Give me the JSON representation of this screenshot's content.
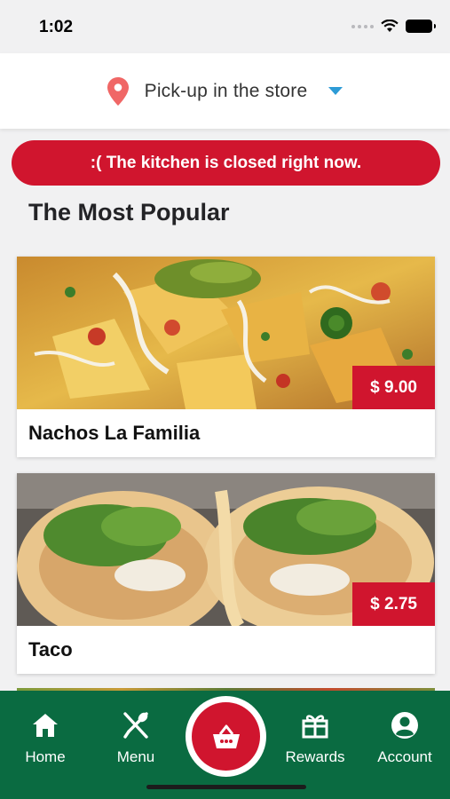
{
  "status_bar": {
    "time": "1:02"
  },
  "location": {
    "label": "Pick-up in the store",
    "icon": "map-pin-icon",
    "pin_color": "#f06766",
    "caret_color": "#2d9bd6"
  },
  "banner": {
    "text": ":( The kitchen is closed right now.",
    "color": "#d0152e"
  },
  "section": {
    "title": "The Most Popular"
  },
  "items": [
    {
      "name": "Nachos La Familia",
      "price": "$ 9.00"
    },
    {
      "name": "Taco",
      "price": "$ 2.75"
    }
  ],
  "nav": {
    "background": "#0a6b41",
    "items": [
      {
        "label": "Home",
        "icon": "home-icon"
      },
      {
        "label": "Menu",
        "icon": "fork-knife-icon"
      },
      {
        "label": "",
        "icon": "basket-icon"
      },
      {
        "label": "Rewards",
        "icon": "gift-icon"
      },
      {
        "label": "Account",
        "icon": "account-icon"
      }
    ]
  }
}
